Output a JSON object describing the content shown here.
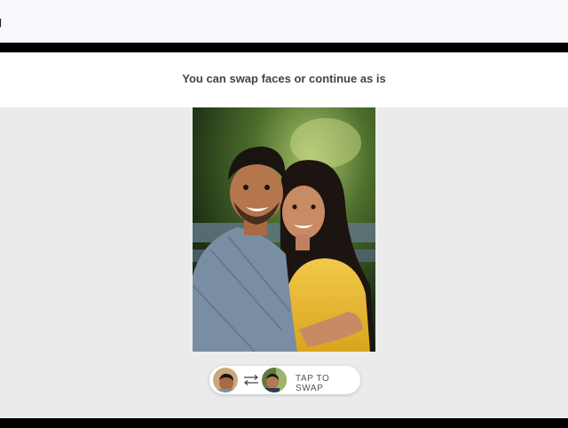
{
  "topbar": {
    "title": "g"
  },
  "heading": {
    "text": "You can swap faces or continue as is"
  },
  "swap": {
    "label": "TAP TO SWAP"
  },
  "icons": {
    "source_face": "face-thumbnail-icon",
    "target_face": "face-thumbnail-icon",
    "swap": "swap-arrows-icon"
  },
  "colors": {
    "background": "#ebebeb",
    "topbar": "#fbf8fd",
    "dress": "#e7b92f",
    "shirt": "#7a8ea3"
  }
}
